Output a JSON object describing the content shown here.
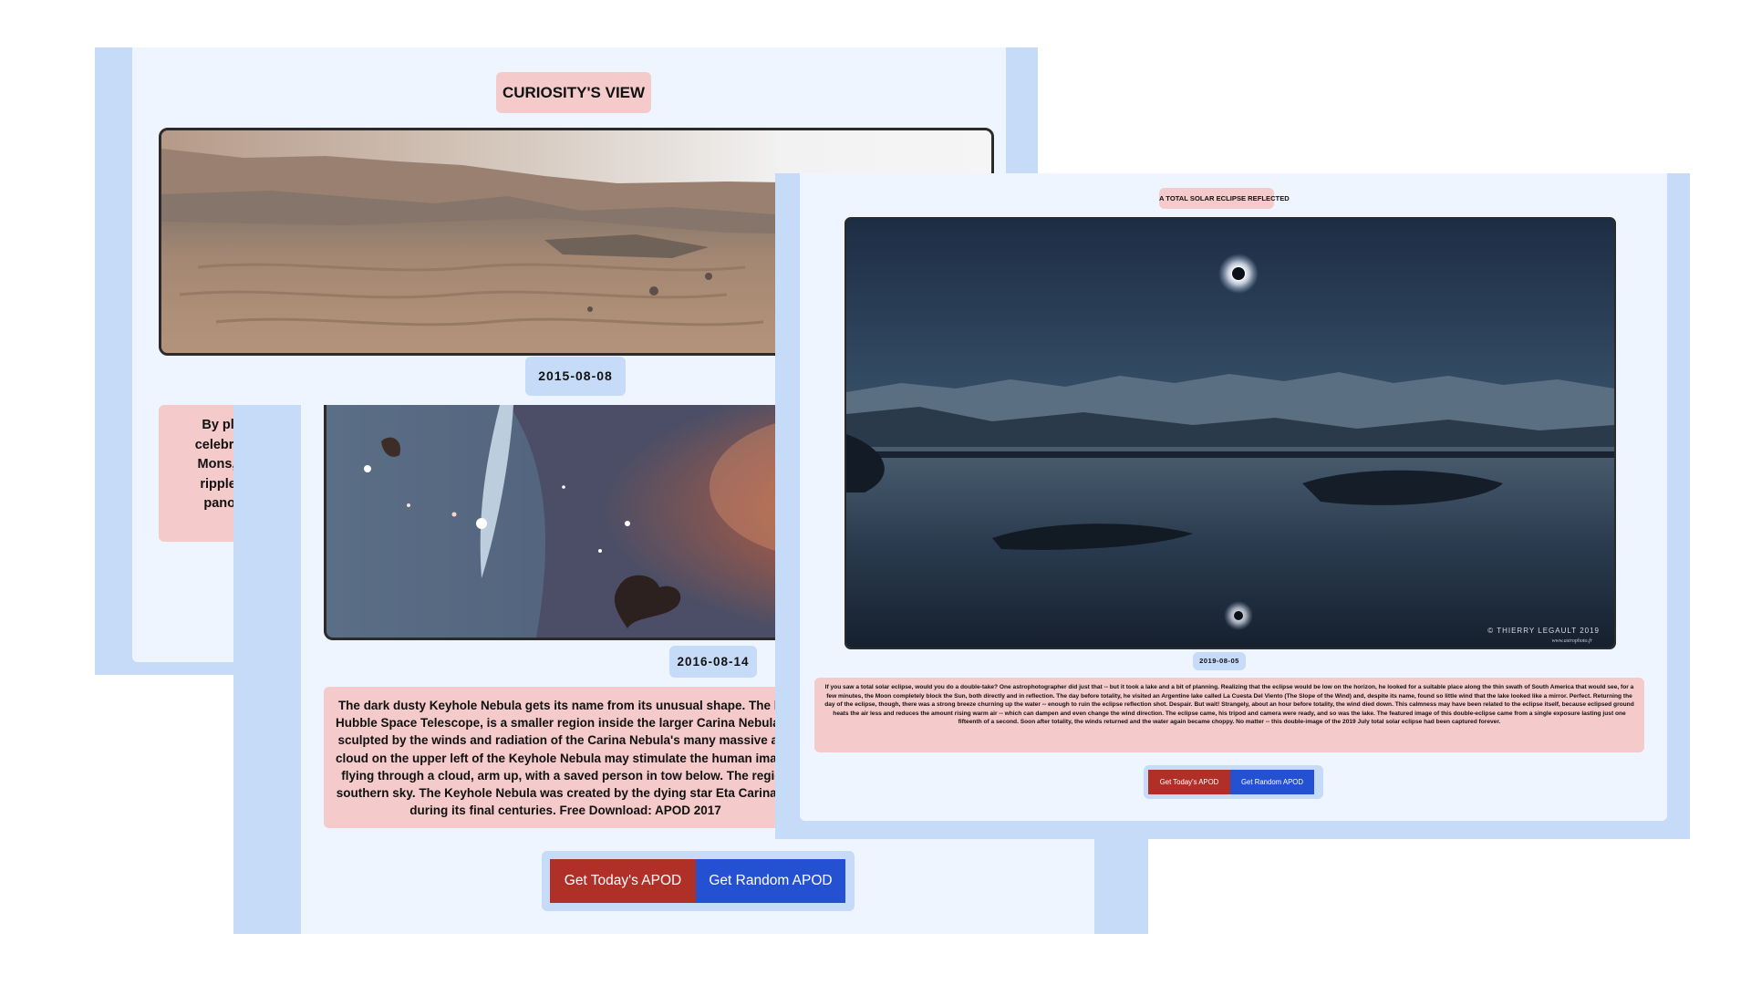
{
  "screens": {
    "curiosity": {
      "title": "CURIOSITY'S VIEW",
      "date": "2015-08-08",
      "description_lines": [
        "By planet",
        "celebrate, g",
        "Mons, also",
        "ripples, ar",
        "panoram"
      ]
    },
    "keyhole": {
      "date": "2016-08-14",
      "description_lines": [
        "The dark dusty Keyhole Nebula gets its name from its unusual shape. The loo",
        "Hubble Space Telescope, is a smaller region inside the larger Carina Nebula. D",
        "sculpted by the winds and radiation of the Carina Nebula's many massive and",
        "cloud on the upper left of the Keyhole Nebula may stimulate the human imagin",
        "flying through a cloud, arm up, with a saved person in tow below. The region",
        "southern sky. The Keyhole Nebula was created by the dying star Eta Carina , o",
        "during its final centuries. Free Download: APOD 2017"
      ],
      "btn_today": "Get Today's APOD",
      "btn_random": "Get Random APOD"
    },
    "eclipse": {
      "title": "A TOTAL SOLAR ECLIPSE REFLECTED",
      "date": "2019-08-05",
      "description": "If you saw a total solar eclipse, would you do a double-take? One astrophotographer did just that -- but it took a lake and a bit of planning. Realizing that the eclipse would be low on the horizon, he looked for a suitable place along the thin swath of South America that would see, for a few minutes, the Moon completely block the Sun, both directly and in reflection. The day before totality, he visited an Argentine lake called La Cuesta Del Viento (The Slope of the Wind) and, despite its name, found so little wind that the lake looked like a mirror. Perfect. Returning the day of the eclipse, though, there was a strong breeze churning up the water -- enough to ruin the eclipse reflection shot. Despair. But wait! Strangely, about an hour before totality, the wind died down. This calmness may have been related to the eclipse itself, because eclipsed ground heats the air less and reduces the amount rising warm air -- which can dampen and even change the wind direction. The eclipse came, his tripod and camera were ready, and so was the lake. The featured image of this double-eclipse came from a single exposure lasting just one fifteenth of a second. Soon after totality, the winds returned and the water again became choppy. No matter -- this double-image of the 2019 July total solar eclipse had been captured forever.",
      "watermark": "© THIERRY LEGAULT 2019",
      "watermark_site": "www.astrophoto.fr",
      "btn_today": "Get Today's APOD",
      "btn_random": "Get Random APOD"
    }
  },
  "colors": {
    "outer_blue": "#c6dbf7",
    "panel": "#eef5fe",
    "pink": "#f4caca",
    "red_button": "#b03028",
    "blue_button": "#2450d2"
  }
}
